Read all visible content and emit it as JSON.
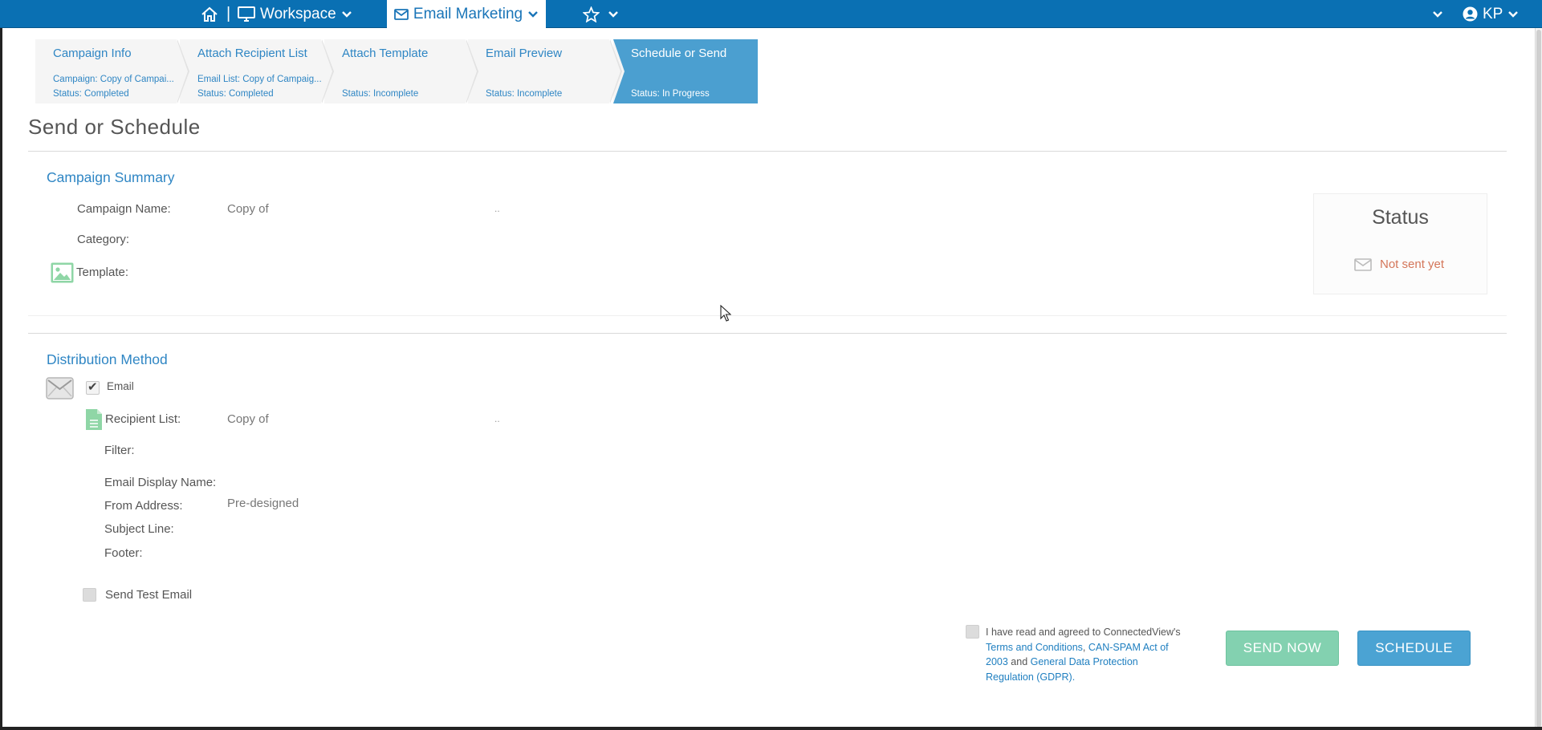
{
  "topbar": {
    "separator": "|",
    "workspace_label": "Workspace",
    "email_marketing_label": "Email Marketing",
    "user_initials": "KP"
  },
  "wizard": {
    "steps": [
      {
        "title": "Campaign Info",
        "line1": "Campaign: Copy of Campai...",
        "line2": "Status: Completed"
      },
      {
        "title": "Attach Recipient List",
        "line1": "Email List: Copy of Campaig...",
        "line2": "Status: Completed"
      },
      {
        "title": "Attach Template",
        "line1": "",
        "line2": "Status: Incomplete"
      },
      {
        "title": "Email Preview",
        "line1": "",
        "line2": "Status: Incomplete"
      },
      {
        "title": "Schedule or Send",
        "line1": "",
        "line2": "Status: In Progress"
      }
    ]
  },
  "page": {
    "title": "Send or Schedule"
  },
  "summary": {
    "section_title": "Campaign Summary",
    "campaign_name_label": "Campaign Name:",
    "campaign_name_value": "Copy of",
    "campaign_name_trail": "..",
    "category_label": "Category:",
    "template_label": "Template:"
  },
  "status": {
    "title": "Status",
    "text": "Not sent yet"
  },
  "distribution": {
    "section_title": "Distribution Method",
    "email_label": "Email",
    "email_checked": true,
    "recipient_list_label": "Recipient List:",
    "recipient_list_value": "Copy of",
    "recipient_list_trail": "..",
    "filter_label": "Filter:",
    "display_name_label": "Email Display Name:",
    "from_address_label": "From Address:",
    "from_address_value": "Pre-designed",
    "subject_label": "Subject Line:",
    "footer_label": "Footer:",
    "send_test_label": "Send Test Email"
  },
  "agreement": {
    "text_prefix": "I have read and agreed to ConnectedView's ",
    "link_terms": "Terms and Conditions",
    "comma": ", ",
    "link_canspam": "CAN-SPAM Act of 2003",
    "and": " and ",
    "link_gdpr": "General Data Protection Regulation (GDPR)",
    "period": "."
  },
  "actions": {
    "send_now_label": "SEND NOW",
    "schedule_label": "SCHEDULE"
  },
  "colors": {
    "topbar": "#0a70b3",
    "accent": "#2f86c4",
    "active_step": "#4b9fd0",
    "status_text": "#d4765a",
    "send_now": "#83d1b0",
    "schedule": "#4ba3d3"
  }
}
